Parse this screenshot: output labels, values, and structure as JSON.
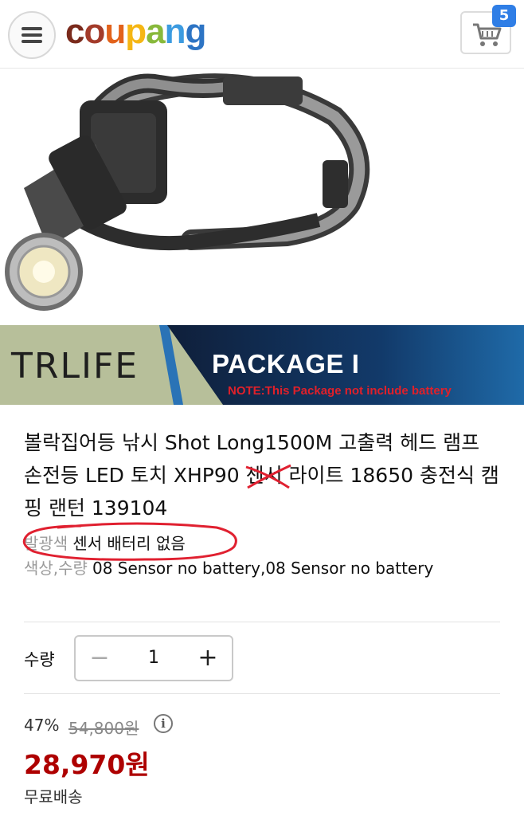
{
  "header": {
    "logo_text": "coupang",
    "cart_count": "5"
  },
  "banner": {
    "brand": "TRLIFE",
    "package_title": "PACKAGE I",
    "package_note": "NOTE:This Package not include battery"
  },
  "product": {
    "title_part1": "볼락집어등 낚시 Shot Long1500M 고출력 헤드 램프 손전등 LED 토치 XHP90 ",
    "title_struck": "센서",
    "title_part2": " 라이트 18650 충전식 캠핑 랜턴 139104"
  },
  "options": {
    "color_label": "발광색",
    "color_value": "센서 배터리 없음",
    "qty_option_label": "색상,수량",
    "qty_option_value": "08 Sensor no battery,08 Sensor no battery"
  },
  "quantity": {
    "label": "수량",
    "minus": "−",
    "value": "1",
    "plus": "+"
  },
  "price": {
    "discount": "47%",
    "original": "54,800원",
    "info_icon": "i",
    "sale": "28,970원",
    "shipping": "무료배송"
  },
  "colors": {
    "sale_price": "#ae0000",
    "annotation": "#e02030",
    "badge": "#2f7ee6"
  }
}
